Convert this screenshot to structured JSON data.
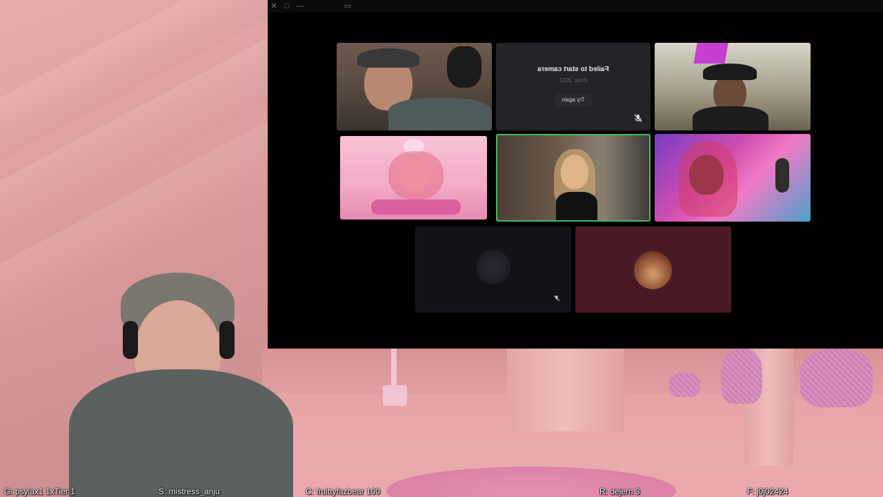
{
  "titlebar": {
    "close_icon": "✕",
    "maximize_icon": "□",
    "minimize_icon": "—",
    "restore_icon": "▭"
  },
  "call_tiles": [
    {
      "name": "participant-man-cap",
      "type": "video"
    },
    {
      "name": "participant-camera-failed",
      "type": "error",
      "error_title": "Failed to start camera",
      "error_code": "Error: 2012",
      "retry_label": "Try again"
    },
    {
      "name": "participant-man-hat",
      "type": "video"
    },
    {
      "name": "participant-pink-vtuber",
      "type": "video"
    },
    {
      "name": "participant-blonde-woman",
      "type": "video",
      "active_speaker": true
    },
    {
      "name": "participant-pink-hair-woman",
      "type": "video"
    },
    {
      "name": "participant-dark-avatar",
      "type": "avatar"
    },
    {
      "name": "participant-hat-avatar",
      "type": "avatar"
    }
  ],
  "colors": {
    "active_speaker_border": "#3fbf5f",
    "avatar_tile_bg": "#4a1a24",
    "dark_tile_bg": "#121316",
    "window_bg": "#000000"
  },
  "hud": {
    "goal": "G: psylax1 1xTier 1",
    "sub": "S: mistress_anju",
    "cheer": "C: fruittyfazbear 100",
    "raid": "R: dejern 3",
    "follow": "F: j0j02424"
  }
}
